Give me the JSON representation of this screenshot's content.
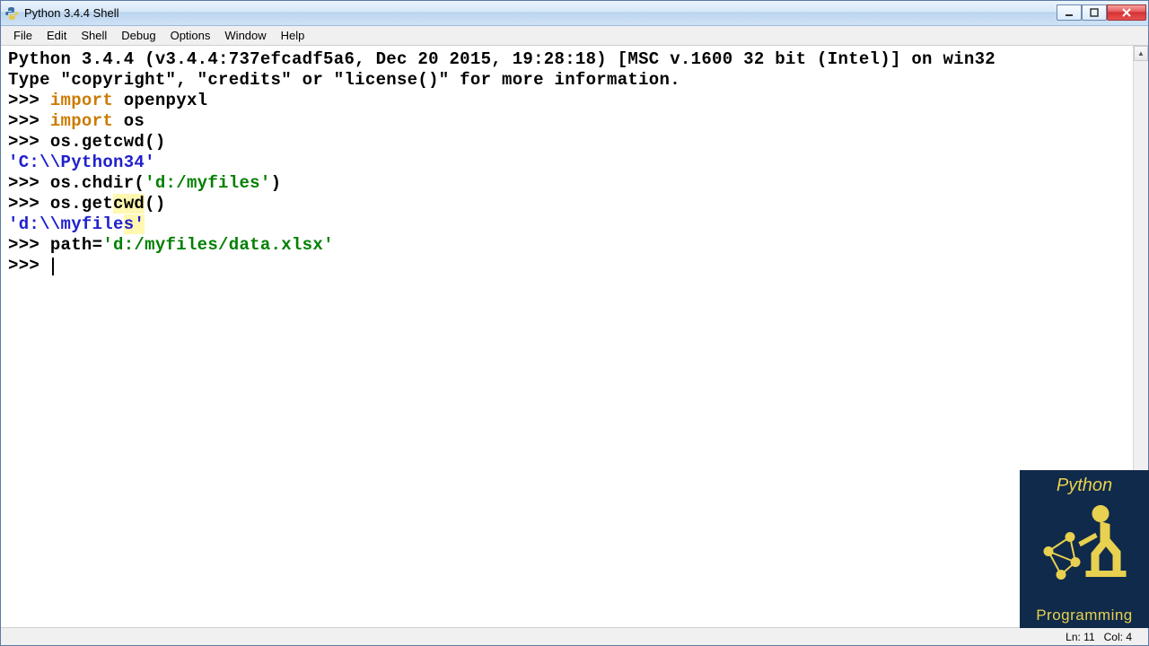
{
  "window": {
    "title": "Python 3.4.4 Shell"
  },
  "menu": {
    "items": [
      "File",
      "Edit",
      "Shell",
      "Debug",
      "Options",
      "Window",
      "Help"
    ]
  },
  "shell": {
    "banner1": "Python 3.4.4 (v3.4.4:737efcadf5a6, Dec 20 2015, 19:28:18) [MSC v.1600 32 bit (Intel)] on win32",
    "banner2": "Type \"copyright\", \"credits\" or \"license()\" for more information.",
    "prompt": ">>> ",
    "lines": {
      "l1_kw": "import",
      "l1_rest": " openpyxl",
      "l2_kw": "import",
      "l2_rest": " os",
      "l3": "os.getcwd()",
      "l3_out": "'C:\\\\Python34'",
      "l4_pre": "os.chdir(",
      "l4_str": "'d:/myfiles'",
      "l4_post": ")",
      "l5_pre": "os.get",
      "l5_hl": "cwd",
      "l5_post": "()",
      "l5_out_pre": "'d:\\\\myfile",
      "l5_out_hl": "s'",
      "l6_pre": "path=",
      "l6_str": "'d:/myfiles/data.xlsx'"
    }
  },
  "status": {
    "line": "Ln: 11",
    "col": "Col: 4"
  },
  "watermark": {
    "top": "Python",
    "bottom": "Programming"
  }
}
